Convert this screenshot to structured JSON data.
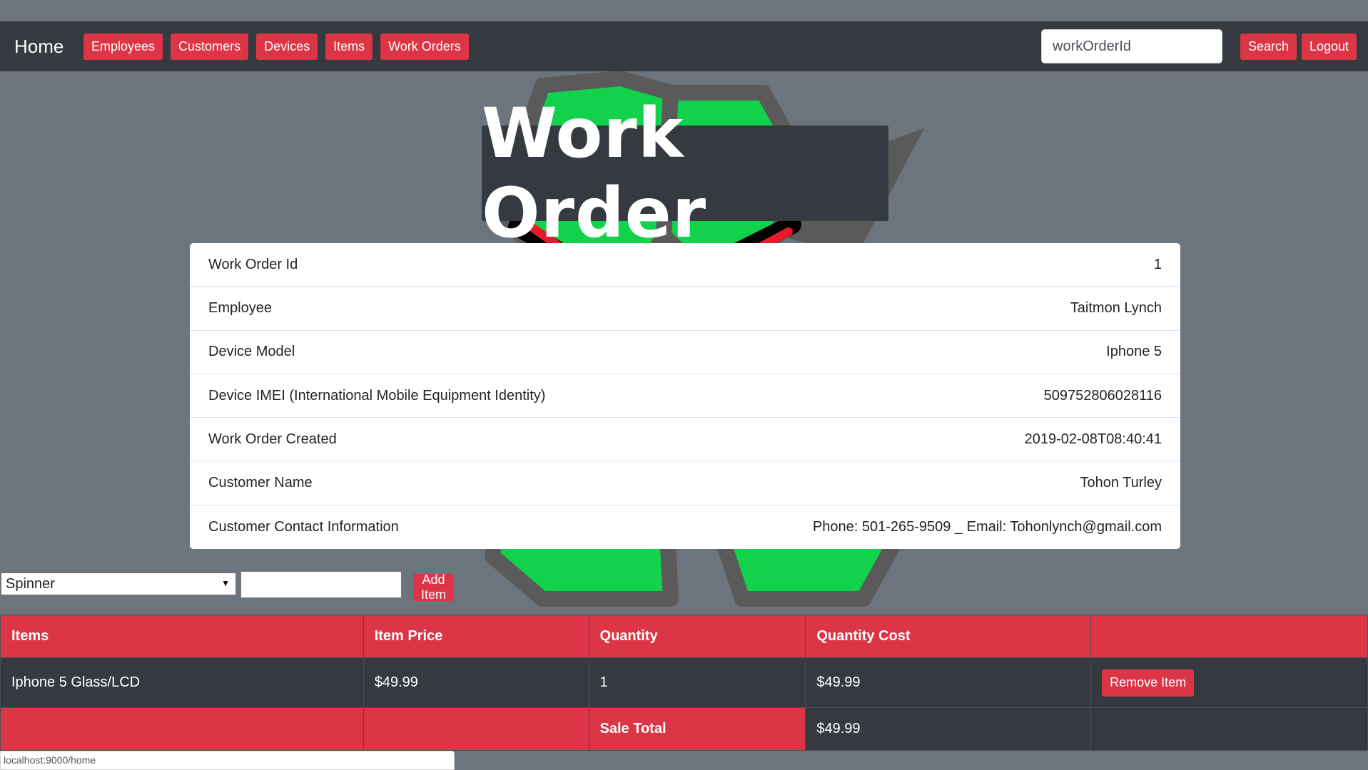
{
  "navbar": {
    "brand": "Home",
    "links": [
      "Employees",
      "Customers",
      "Devices",
      "Items",
      "Work Orders"
    ],
    "search_value": "workOrderId",
    "search_label": "Search",
    "logout_label": "Logout"
  },
  "title": "Work Order",
  "work_order": [
    {
      "label": "Work Order Id",
      "value": "1"
    },
    {
      "label": "Employee",
      "value": "Taitmon Lynch"
    },
    {
      "label": "Device Model",
      "value": "Iphone 5"
    },
    {
      "label": "Device IMEI (International Mobile Equipment Identity)",
      "value": "509752806028116"
    },
    {
      "label": "Work Order Created",
      "value": "2019-02-08T08:40:41"
    },
    {
      "label": "Customer Name",
      "value": "Tohon Turley"
    },
    {
      "label": "Customer Contact Information",
      "value": "Phone: 501-265-9509 _ Email: Tohonlynch@gmail.com"
    }
  ],
  "add_item": {
    "select_value": "Spinner",
    "quantity_value": "",
    "button_label": "Add Item"
  },
  "items_table": {
    "headers": [
      "Items",
      "Item Price",
      "Quantity",
      "Quantity Cost",
      ""
    ],
    "rows": [
      {
        "item": "Iphone 5 Glass/LCD",
        "price": "$49.99",
        "quantity": "1",
        "cost": "$49.99",
        "action": "Remove Item"
      }
    ],
    "total_label": "Sale Total",
    "total_value": "$49.99"
  },
  "status_url": "localhost:9000/home",
  "colors": {
    "accent": "#dc3545",
    "dark": "#343a40",
    "background": "#6c757d",
    "logo_green": "#11d24a"
  }
}
